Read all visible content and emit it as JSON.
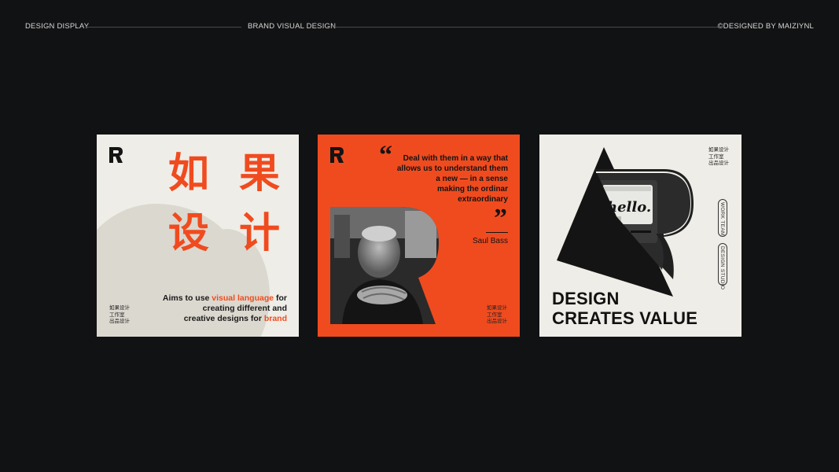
{
  "header": {
    "left": "DESIGN DISPLAY",
    "center": "BRAND VISUAL DESIGN",
    "right": "©DESIGNED BY MAIZIYNL"
  },
  "card1": {
    "title_line1": "如 果",
    "title_line2": "设 计",
    "studio_lines": [
      "如果设计",
      "工作室",
      "出品设计"
    ],
    "text_a": "Aims to use ",
    "text_hl1": "visual language",
    "text_b": " for",
    "text_line2": "creating different and",
    "text_c": "creative designs for ",
    "text_hl2": "brand"
  },
  "card2": {
    "quote_lines": [
      "Deal with them in a way that",
      "allows us to understand them",
      "a new — in a sense",
      "making the ordinar",
      "extraordinary"
    ],
    "open_quote": "“",
    "close_quote": "”",
    "author": "Saul Bass",
    "studio_lines": [
      "如果设计",
      "工作室",
      "出品设计"
    ]
  },
  "card3": {
    "screen_text": "hello.",
    "headline_line1": "DESIGN",
    "headline_line2": "CREATES VALUE",
    "studio_lines": [
      "如果设计",
      "工作室",
      "出品设计"
    ],
    "vertical_1": "WORK TEAM",
    "vertical_2": "DESIGN STUDIO"
  },
  "colors": {
    "accent": "#f04b1f",
    "paper": "#efede7",
    "ink": "#111111",
    "background": "#111214"
  }
}
